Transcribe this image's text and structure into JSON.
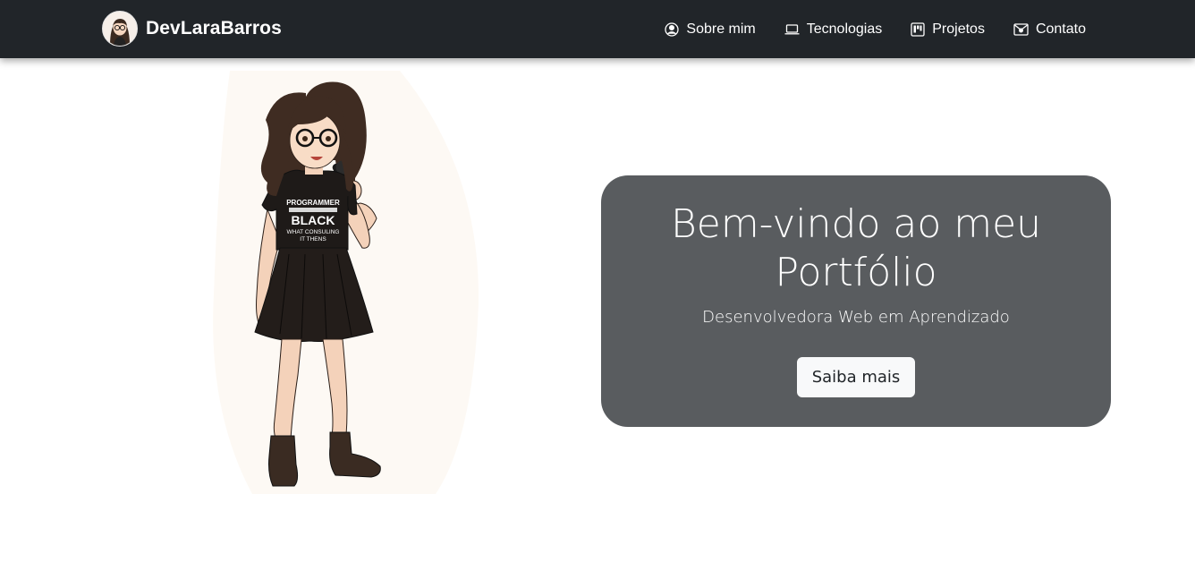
{
  "navbar": {
    "brand": "DevLaraBarros",
    "links": [
      {
        "label": "Sobre mim",
        "icon": "person-circle-icon"
      },
      {
        "label": "Tecnologias",
        "icon": "laptop-icon"
      },
      {
        "label": "Projetos",
        "icon": "kanban-icon"
      },
      {
        "label": "Contato",
        "icon": "envelope-icon"
      }
    ]
  },
  "hero": {
    "illustration": "girl-with-microphone-illustration",
    "shirt_text": [
      "PROGRAMMER",
      "BLACK",
      "WHAT CONSULING",
      "IT THENS"
    ],
    "title": "Bem-vindo ao meu Portfólio",
    "subtitle": "Desenvolvedora Web em Aprendizado",
    "button": "Saiba mais"
  },
  "colors": {
    "navbar_bg": "#212529",
    "card_bg": "#595c5f",
    "button_bg": "#f8f9fa"
  }
}
